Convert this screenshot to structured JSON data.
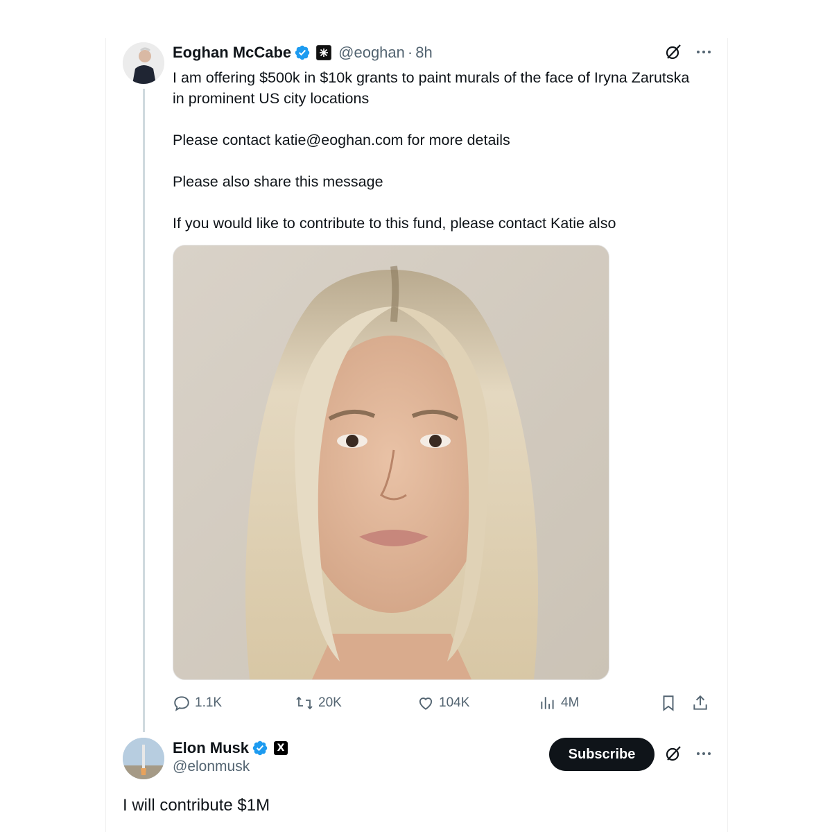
{
  "tweet": {
    "author_name": "Eoghan McCabe",
    "handle": "@eoghan",
    "separator": "·",
    "time": "8h",
    "paragraphs": [
      "I am offering $500k in $10k grants to paint murals of the face of Iryna Zarutska in prominent US city locations",
      "Please contact katie@eoghan.com for more details",
      "Please also share this message",
      "If you would like to contribute to this fund, please contact Katie also"
    ],
    "media": {
      "type": "photo",
      "subject": "portrait-of-blonde-woman"
    },
    "actions": {
      "replies": "1.1K",
      "reposts": "20K",
      "likes": "104K",
      "views": "4M"
    }
  },
  "reply": {
    "author_name": "Elon Musk",
    "handle": "@elonmusk",
    "affiliation_badge": "X",
    "subscribe_label": "Subscribe",
    "text": "I will contribute $1M"
  },
  "colors": {
    "verified_blue": "#1d9bf0",
    "text_primary": "#0f1419",
    "text_secondary": "#536471",
    "thread_line": "#cfd9de",
    "button_dark": "#0f1419"
  },
  "icons": {
    "verified": "verified-badge-icon",
    "grok": "grok-icon",
    "more": "more-options-icon",
    "reply": "reply-icon",
    "repost": "repost-icon",
    "like": "heart-icon",
    "views": "views-icon",
    "bookmark": "bookmark-icon",
    "share": "share-icon"
  }
}
